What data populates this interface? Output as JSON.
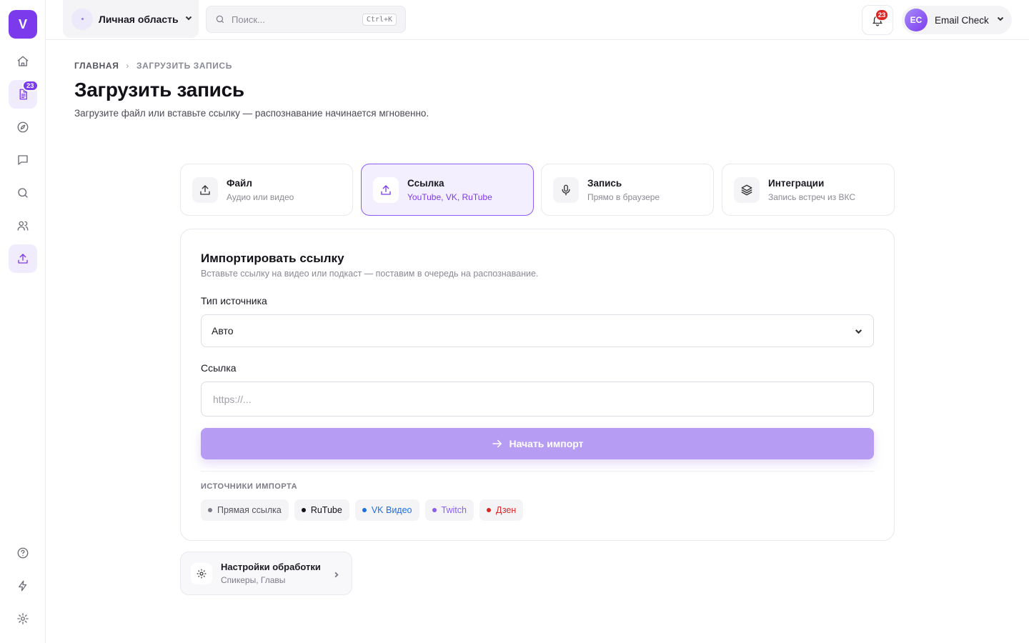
{
  "app": {
    "logo_letter": "V",
    "accent": "#7c3aed"
  },
  "sidebar": {
    "items": [
      {
        "icon": "home-icon",
        "active": false
      },
      {
        "icon": "document-icon",
        "active": false,
        "badge": "23"
      },
      {
        "icon": "compass-icon",
        "active": false
      },
      {
        "icon": "chat-icon",
        "active": false
      },
      {
        "icon": "search-icon",
        "active": false
      },
      {
        "icon": "users-icon",
        "active": false
      },
      {
        "icon": "upload-icon",
        "active": true
      }
    ],
    "bottom": [
      {
        "icon": "help-icon"
      },
      {
        "icon": "lightning-icon"
      },
      {
        "icon": "gear-icon"
      }
    ]
  },
  "topbar": {
    "workspace_label": "Личная область",
    "search_placeholder": "Поиск...",
    "search_shortcut": "Ctrl+K",
    "notifications_count": "23",
    "user_initials": "EC",
    "user_name": "Email Check"
  },
  "breadcrumb": {
    "home": "ГЛАВНАЯ",
    "current": "ЗАГРУЗИТЬ ЗАПИСЬ"
  },
  "page": {
    "title": "Загрузить запись",
    "subtitle": "Загрузите файл или вставьте ссылку — распознавание начинается мгновенно."
  },
  "modes": [
    {
      "title": "Файл",
      "subtitle": "Аудио или видео",
      "icon": "upload-icon",
      "active": false
    },
    {
      "title": "Ссылка",
      "subtitle": "YouTube, VK, RuTube",
      "icon": "link-upload-icon",
      "active": true
    },
    {
      "title": "Запись",
      "subtitle": "Прямо в браузере",
      "icon": "microphone-icon",
      "active": false
    },
    {
      "title": "Интеграции",
      "subtitle": "Запись встреч из ВКС",
      "icon": "layers-icon",
      "active": false
    }
  ],
  "import_form": {
    "title": "Импортировать ссылку",
    "subtitle": "Вставьте ссылку на видео или подкаст — поставим в очередь на распознавание.",
    "source_type_label": "Тип источника",
    "source_type_value": "Авто",
    "link_label": "Ссылка",
    "link_placeholder": "https://...",
    "link_value": "",
    "submit_label": "Начать импорт",
    "sources_heading": "ИСТОЧНИКИ ИМПОРТА",
    "sources": [
      {
        "label": "Прямая ссылка",
        "color": "#55555f",
        "dot": "#7b7b88"
      },
      {
        "label": "RuTube",
        "color": "#111118",
        "dot": "#111118"
      },
      {
        "label": "VK Видео",
        "color": "#1d6fe0",
        "dot": "#1d6fe0"
      },
      {
        "label": "Twitch",
        "color": "#8b5cf6",
        "dot": "#8b5cf6"
      },
      {
        "label": "Дзен",
        "color": "#dc2626",
        "dot": "#dc2626"
      }
    ]
  },
  "processing_settings": {
    "title": "Настройки обработки",
    "subtitle": "Спикеры, Главы"
  }
}
